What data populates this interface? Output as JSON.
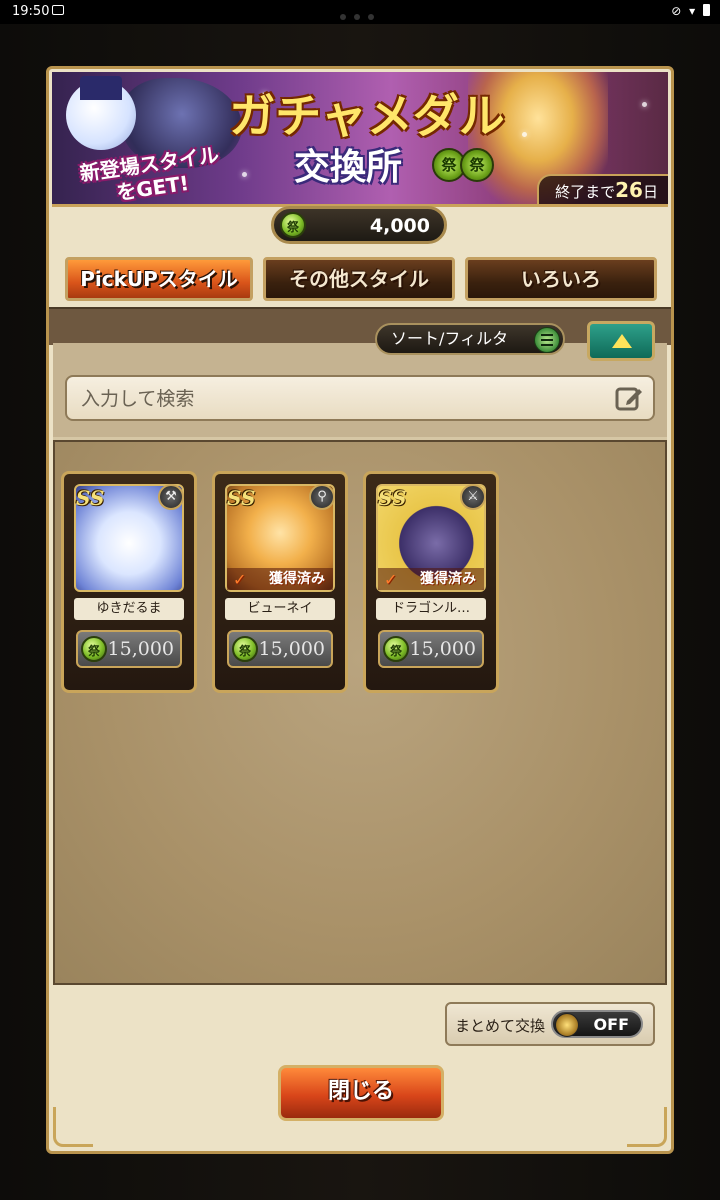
{
  "status_bar": {
    "time": "19:50"
  },
  "banner": {
    "title": "ガチャメダル",
    "subtitle": "交換所",
    "medal_glyph": "祭",
    "tagline_line1": "新登場スタイル",
    "tagline_line2": "をGET!",
    "remaining_prefix": "終了まで",
    "remaining_days": "26",
    "remaining_suffix": "日"
  },
  "currency": {
    "icon": "medal-icon",
    "value": "4,000"
  },
  "tabs": [
    {
      "label": "PickUPスタイル",
      "active": true
    },
    {
      "label": "その他スタイル",
      "active": false
    },
    {
      "label": "いろいろ",
      "active": false
    }
  ],
  "filter": {
    "sort_label": "ソート/フィルタ"
  },
  "search": {
    "placeholder": "入力して検索"
  },
  "items": [
    {
      "name": "ゆきだるま",
      "price": "15,000",
      "owned": false,
      "weapon_icon": "hammer-icon"
    },
    {
      "name": "ビューネイ",
      "price": "15,000",
      "owned": true,
      "owned_label": "獲得済み",
      "weapon_icon": "staff-icon"
    },
    {
      "name": "ドラゴンル…",
      "price": "15,000",
      "owned": true,
      "owned_label": "獲得済み",
      "weapon_icon": "axe-icon"
    }
  ],
  "item_badge": "SS",
  "bulk_exchange": {
    "label": "まとめて交換",
    "state": "OFF"
  },
  "close_button": {
    "label": "閉じる"
  },
  "colors": {
    "tab_active": "#e0611f",
    "frame_gold": "#c9a55a",
    "medal_green": "#7ebd27"
  }
}
